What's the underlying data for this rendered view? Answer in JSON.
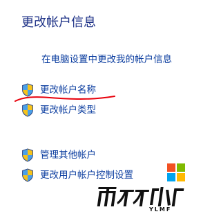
{
  "page": {
    "title": "更改帐户信息"
  },
  "links": {
    "pc_settings": "在电脑设置中更改我的帐户信息",
    "change_name": "更改帐户名称",
    "change_type": "更改帐户类型",
    "manage_other": "管理其他帐户",
    "uac_settings": "更改用户帐户控制设置"
  },
  "watermark": {
    "brand_main": "雨林木风",
    "brand_sub": "YLMF",
    "logo_colors": [
      "#f25022",
      "#7fba00",
      "#00a4ef",
      "#ffb900"
    ]
  },
  "annotation": {
    "color": "#e8000b"
  },
  "icons": {
    "shield": "uac-shield-icon"
  }
}
